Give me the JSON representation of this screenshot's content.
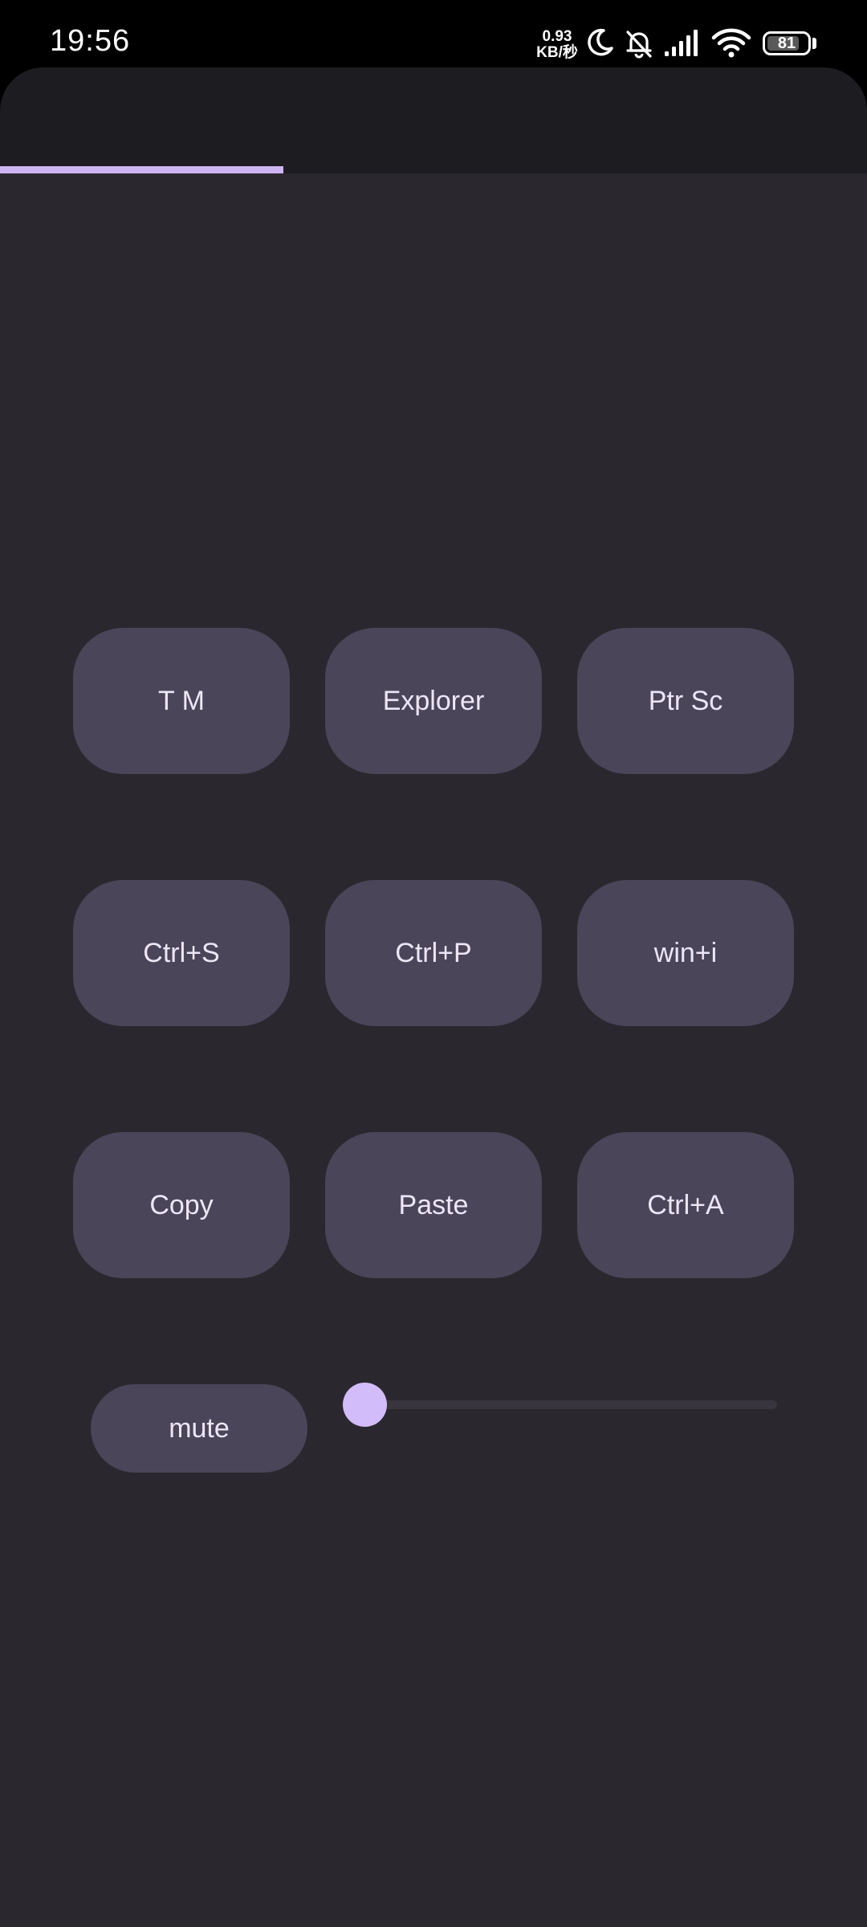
{
  "status_bar": {
    "time": "19:56",
    "net_speed_value": "0.93",
    "net_speed_unit": "KB/秒",
    "battery_level": "81",
    "icons": [
      "moon-icon",
      "bell-off-icon",
      "cellular-signal-icon",
      "wifi-icon",
      "battery-icon"
    ]
  },
  "progress": {
    "fraction": 0.327
  },
  "keys": {
    "row1": [
      "T M",
      "Explorer",
      "Ptr Sc"
    ],
    "row2": [
      "Ctrl+S",
      "Ctrl+P",
      "win+i"
    ],
    "row3": [
      "Copy",
      "Paste",
      "Ctrl+A"
    ]
  },
  "volume": {
    "mute_label": "mute",
    "slider_value": 0
  },
  "colors": {
    "background": "#2a282e",
    "app_bar": "#1d1c21",
    "button": "#4a4559",
    "button_text": "#ece6f6",
    "accent": "#d3bcfa",
    "slider_track": "#38353d"
  }
}
